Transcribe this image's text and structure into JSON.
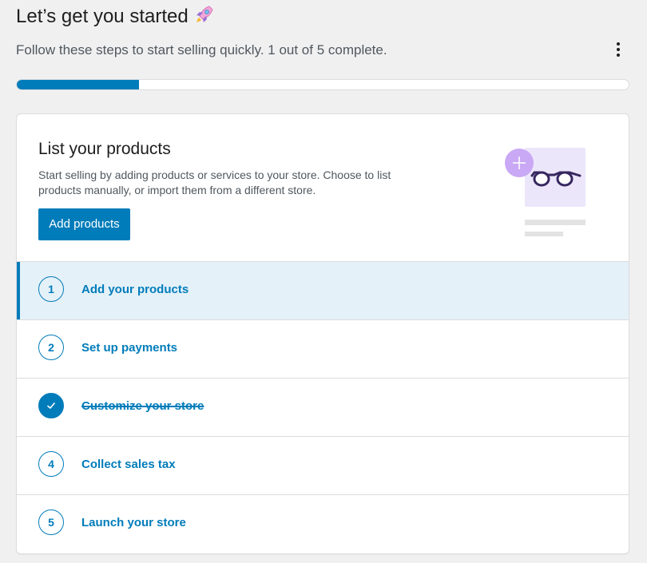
{
  "header": {
    "title": "Let’s get you started",
    "title_emoji_icon": "rocket-icon",
    "subtitle": "Follow these steps to start selling quickly. 1 out of 5 complete.",
    "more_icon": "more-vertical-icon",
    "progress_fraction": 0.2
  },
  "hero": {
    "title": "List your products",
    "description": "Start selling by adding products or services to your store. Choose to list products manually, or import them from a different store.",
    "button_label": "Add products",
    "illustration_icon": "glasses-product-illustration"
  },
  "steps": [
    {
      "number": "1",
      "label": "Add your products",
      "state": "active"
    },
    {
      "number": "2",
      "label": "Set up payments",
      "state": "pending"
    },
    {
      "number": "",
      "label": "Customize your store",
      "state": "complete",
      "icon": "check-icon"
    },
    {
      "number": "4",
      "label": "Collect sales tax",
      "state": "pending"
    },
    {
      "number": "5",
      "label": "Launch your store",
      "state": "pending"
    }
  ],
  "colors": {
    "accent": "#007cba",
    "active_row": "#e5f1f8",
    "page_bg": "#f0f0f1",
    "illustration_purple": "#c9a8f5"
  }
}
